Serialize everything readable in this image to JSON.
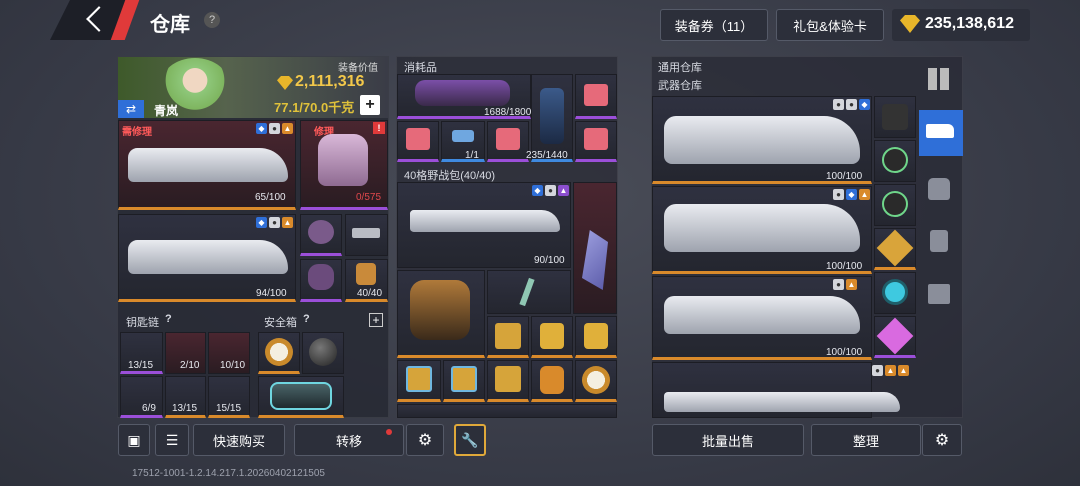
{
  "header": {
    "title": "仓库",
    "help": "?",
    "voucher_button": "装备券（11）",
    "gift_button": "礼包&体验卡",
    "currency": "235,138,612"
  },
  "character": {
    "value_label": "装备价值",
    "value": "2,111,316",
    "weight": "77.1/70.0千克",
    "name": "青岚",
    "add": "+"
  },
  "equipment": {
    "weapon1_tag": "需修理",
    "weapon1_count": "65/100",
    "armor_tag": "修理",
    "armor_count": "0/575",
    "weapon2_count": "94/100",
    "ammo_count": "40/40"
  },
  "keychain": {
    "label": "钥匙链",
    "help": "?",
    "counts": [
      "13/15",
      "2/10",
      "10/10",
      "6/9",
      "13/15",
      "15/15"
    ]
  },
  "safe": {
    "label": "安全箱",
    "help": "?",
    "add": "+"
  },
  "consumables": {
    "label": "消耗品",
    "counts": [
      "1688/1800",
      "1/1",
      "235/1440"
    ]
  },
  "backpack": {
    "label": "40格野战包(40/40)",
    "count": "90/100"
  },
  "warehouse": {
    "general_label": "通用仓库",
    "weapon_label": "武器仓库",
    "counts": [
      "100/100",
      "100/100",
      "100/100"
    ]
  },
  "bottom": {
    "quick_buy": "快速购买",
    "transfer": "转移",
    "bulk_sell": "批量出售",
    "sort": "整理",
    "version": "17512-1001-1.2.14.217.1.20260402121505"
  }
}
